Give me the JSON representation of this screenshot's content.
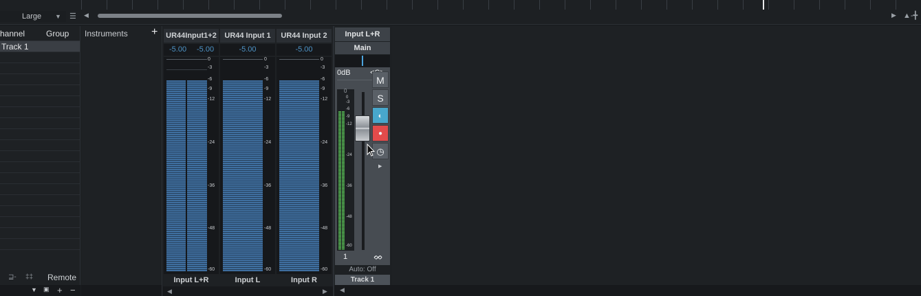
{
  "toolbar": {
    "size_label": "Large",
    "caret": "▼",
    "list_icon": "☰",
    "scroll_left": "◀",
    "scroll_right": "▶",
    "zoom_icon": "▲-╋"
  },
  "left_panel": {
    "col_channel": "hannel",
    "col_group": "Group",
    "track_name": "Track 1",
    "remote_label": "Remote",
    "bottom_icons": [
      "▼",
      "🔒",
      "+",
      "−"
    ]
  },
  "instruments": {
    "title": "Instruments",
    "add": "+"
  },
  "strips": [
    {
      "name": "UR44Input1+2",
      "gains": [
        "-5.00",
        "-5.00"
      ],
      "label": "Input L+R"
    },
    {
      "name": "UR44 Input 1",
      "gains": [
        "-5.00"
      ],
      "label": "Input L"
    },
    {
      "name": "UR44 Input 2",
      "gains": [
        "-5.00"
      ],
      "label": "Input R"
    }
  ],
  "meter_scale": [
    "0",
    "-3",
    "-6",
    "-9",
    "-12",
    "-24",
    "-36",
    "-48",
    "-60"
  ],
  "main_strip": {
    "input": "Input L+R",
    "output": "Main",
    "volume": "0dB",
    "pan": "<C>",
    "peak": "0",
    "scale": [
      "0",
      "-3",
      "-6",
      "-9",
      "-12",
      "-24",
      "-36",
      "-48",
      "-60"
    ],
    "mute": "M",
    "solo": "S",
    "monitor_icon": "◐",
    "record_icon": "●",
    "timing_icon": "◷",
    "expand_icon": "▶",
    "number": "1",
    "automation": "Auto: Off",
    "track_name": "Track 1",
    "colors": {
      "monitor": "#48a7cc",
      "record": "#e24b4b"
    }
  }
}
